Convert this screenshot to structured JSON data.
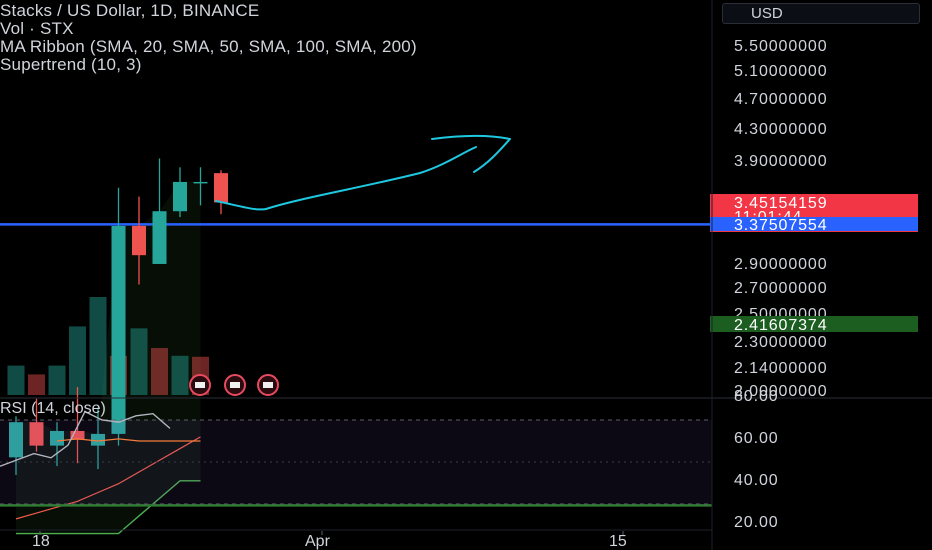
{
  "legend": {
    "title": "Stacks / US Dollar, 1D, BINANCE",
    "volume": "Vol · STX",
    "ma_ribbon": "MA Ribbon (SMA, 20, SMA, 50, SMA, 100, SMA, 200)",
    "supertrend": "Supertrend (10, 3)"
  },
  "currency_button": "USD",
  "rsi_title": "RSI (14, close)",
  "colors": {
    "up": "#26a69a",
    "down": "#ef5350",
    "blue_line": "#2962ff",
    "green_line": "#2e7d32",
    "rsi_line": "#b2b5be",
    "rsi_ma": "#f57c3c",
    "arrow": "#1ec8e0",
    "ma_line": "#f45a4a",
    "supertrend": "#4caf50"
  },
  "chart_data": {
    "type": "candlestick",
    "price_axis": {
      "ticks": [
        "5.50000000",
        "5.10000000",
        "4.70000000",
        "4.30000000",
        "3.90000000",
        "2.90000000",
        "2.70000000",
        "2.50000000",
        "2.30000000",
        "2.14000000",
        "2.00000000"
      ],
      "labels": [
        {
          "text": "3.45154159",
          "value": 3.4515,
          "color": "#f23645"
        },
        {
          "text": "11:01:44",
          "value": 3.4515,
          "color": "#f23645",
          "below": true
        },
        {
          "text": "3.37507554",
          "value": 3.375,
          "color": "#2962ff"
        },
        {
          "text": "2.41607374",
          "value": 2.416,
          "color": "#1b5e20"
        }
      ]
    },
    "candles": [
      {
        "o": 2.58,
        "h": 2.72,
        "l": 2.52,
        "c": 2.7
      },
      {
        "o": 2.7,
        "h": 2.78,
        "l": 2.6,
        "c": 2.62
      },
      {
        "o": 2.62,
        "h": 2.7,
        "l": 2.55,
        "c": 2.67
      },
      {
        "o": 2.67,
        "h": 2.82,
        "l": 2.56,
        "c": 2.64
      },
      {
        "o": 2.62,
        "h": 2.75,
        "l": 2.54,
        "c": 2.66
      },
      {
        "o": 2.66,
        "h": 3.5,
        "l": 2.62,
        "c": 3.37
      },
      {
        "o": 3.37,
        "h": 3.47,
        "l": 3.17,
        "c": 3.27
      },
      {
        "o": 3.24,
        "h": 3.6,
        "l": 3.24,
        "c": 3.42
      },
      {
        "o": 3.42,
        "h": 3.57,
        "l": 3.4,
        "c": 3.52
      },
      {
        "o": 3.52,
        "h": 3.57,
        "l": 3.44,
        "c": 3.52
      },
      {
        "o": 3.55,
        "h": 3.56,
        "l": 3.41,
        "c": 3.45
      }
    ],
    "volume_relative": [
      0.3,
      0.21,
      0.3,
      0.7,
      1.0,
      0.4,
      0.68,
      0.48,
      0.4,
      0.39
    ],
    "volume_colors": [
      "up",
      "down",
      "up",
      "up",
      "up",
      "down",
      "up",
      "down",
      "up",
      "down"
    ],
    "ma_line": [
      2.37,
      2.39,
      2.41,
      2.43,
      2.46,
      2.49,
      2.53,
      2.57,
      2.61,
      2.65
    ],
    "supertrend": [
      2.32,
      2.32,
      2.32,
      2.32,
      2.32,
      2.32,
      2.38,
      2.44,
      2.5,
      2.5
    ],
    "horizontal_lines": [
      {
        "value": 3.375,
        "color": "blue_line"
      },
      {
        "value": 2.416,
        "color": "green_line"
      }
    ],
    "rsi": {
      "ticks": [
        "80.00",
        "60.00",
        "40.00",
        "20.00"
      ],
      "levels": [
        70,
        30
      ],
      "values": [
        48,
        51,
        54,
        52,
        58,
        74,
        70,
        69,
        72,
        73,
        66
      ],
      "ma": [
        60,
        61,
        60,
        61,
        60,
        60,
        60,
        60
      ]
    },
    "x_axis": {
      "ticks": [
        "18",
        "Apr",
        "15"
      ]
    }
  }
}
